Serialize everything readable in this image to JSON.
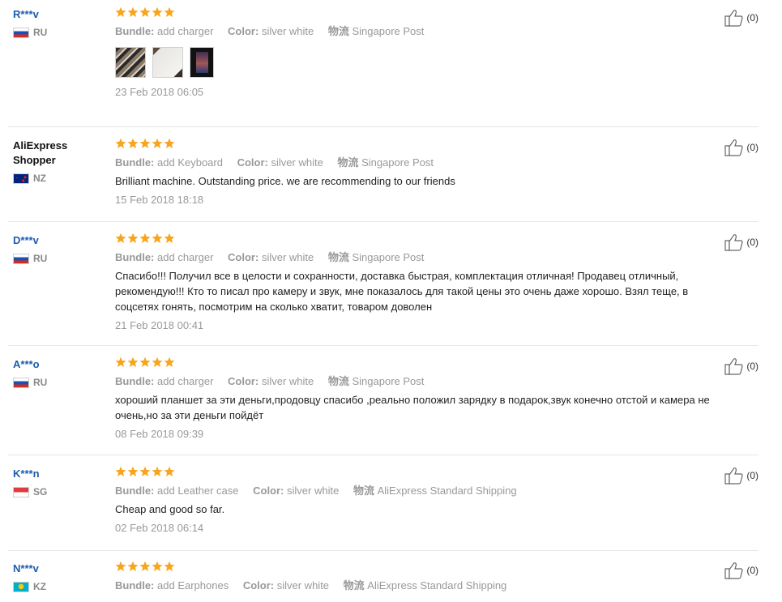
{
  "labels": {
    "bundle": "Bundle:",
    "color": "Color:",
    "shipping": "物流"
  },
  "colors": {
    "star": "#f7a51c",
    "user_link": "#1b5cad",
    "meta_text": "#999999",
    "divider": "#e6e6e6"
  },
  "reviews": [
    {
      "user": "R***v",
      "country": "RU",
      "flag": "russia",
      "stars": 5,
      "bundle": "add charger",
      "color": "silver white",
      "shipping": "Singapore Post",
      "text": "",
      "photos": [
        "photo-1",
        "photo-2",
        "photo-3"
      ],
      "date": "23 Feb 2018 06:05",
      "helpful": "(0)"
    },
    {
      "user": "AliExpress Shopper",
      "country": "NZ",
      "flag": "new-zealand",
      "stars": 5,
      "bundle": "add Keyboard",
      "color": "silver white",
      "shipping": "Singapore Post",
      "text": "Brilliant machine. Outstanding price. we are recommending to our friends",
      "date": "15 Feb 2018 18:18",
      "helpful": "(0)"
    },
    {
      "user": "D***v",
      "country": "RU",
      "flag": "russia",
      "stars": 5,
      "bundle": "add charger",
      "color": "silver white",
      "shipping": "Singapore Post",
      "text": "Спасибо!!! Получил все в целости и сохранности, доставка быстрая, комплектация отличная! Продавец отличный, рекомендую!!! Кто то писал про камеру и звук, мне показалось для такой цены это очень даже хорошо. Взял теще, в соцсетях гонять, посмотрим на сколько хватит, товаром доволен",
      "date": "21 Feb 2018 00:41",
      "helpful": "(0)"
    },
    {
      "user": "A***o",
      "country": "RU",
      "flag": "russia",
      "stars": 5,
      "bundle": "add charger",
      "color": "silver white",
      "shipping": "Singapore Post",
      "text": "хороший планшет за эти деньги,продовцу спасибо ,реально положил зарядку в подарок,звук конечно отстой и камера не очень,но за эти деньги пойдёт",
      "date": "08 Feb 2018 09:39",
      "helpful": "(0)"
    },
    {
      "user": "K***n",
      "country": "SG",
      "flag": "singapore",
      "stars": 5,
      "bundle": "add Leather case",
      "color": "silver white",
      "shipping": "AliExpress Standard Shipping",
      "text": "Cheap and good so far.",
      "date": "02 Feb 2018 06:14",
      "helpful": "(0)"
    },
    {
      "user": "N***v",
      "country": "KZ",
      "flag": "kazakhstan",
      "stars": 5,
      "bundle": "add Earphones",
      "color": "silver white",
      "shipping": "AliExpress Standard Shipping",
      "text": "",
      "date": "",
      "helpful": "(0)"
    }
  ]
}
